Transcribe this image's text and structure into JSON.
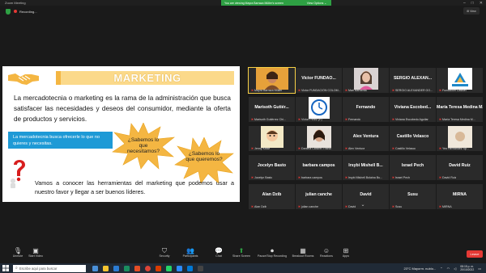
{
  "window": {
    "title": "Zoom Meeting",
    "share_banner": "You are viewing Mayra Barraza Müller's screen",
    "view_options": "View Options ⌄",
    "recording": "Recording...",
    "speaker_view": "⊞ View"
  },
  "slide": {
    "title": "MARKETING",
    "paragraph": "La mercadotecnia o marketing es la rama de la administración que busca satisfacer las necesidades y deseos del consumidor, mediante la oferta de productos y servicios.",
    "blue_box": "La mercadotecnia busca ofrecerle lo que no quieres y necesitas.",
    "burst1": "¿Sabemos lo que necesitamos?",
    "burst2": "¿Sabemos lo que queremos?",
    "bottom_text": "Vamos a conocer las herramientas del marketing que podemos usar a nuestro favor y llegar a ser buenos líderes."
  },
  "gallery": {
    "participants": [
      {
        "name": "",
        "label": "Mayra Barraza Müller",
        "photo": "woman-yellow"
      },
      {
        "name": "Victor FUNDAO...",
        "label": "Victor FUNDACIÓN COLOM..."
      },
      {
        "name": "",
        "label": "Mari Barberita",
        "photo": "girl-pink"
      },
      {
        "name": "SERGIO ALEXAN...",
        "label": "SERGIO ALEXANDER GO..."
      },
      {
        "name": "",
        "label": "Fundación Cassiel",
        "photo": "logo-fundacion"
      },
      {
        "name": "Marisoth Gutiér...",
        "label": "Marisoth Gutiérrez Chi..."
      },
      {
        "name": "",
        "label": "Víctor Pérez (P)",
        "photo": "clock-logo"
      },
      {
        "name": "Fernando",
        "label": "Fernando"
      },
      {
        "name": "Viviana Escobed...",
        "label": "Viviana Escobedo Aguilar"
      },
      {
        "name": "María Teresa Medina M...",
        "label": "María Teresa Medina M..."
      },
      {
        "name": "",
        "label": "Jenny Kisse",
        "photo": "cartoon"
      },
      {
        "name": "",
        "label": "Daniela Caravel Triana",
        "photo": "girl-face"
      },
      {
        "name": "Alex Ventura",
        "label": "Alex Ventura"
      },
      {
        "name": "Castillo Velasco",
        "label": "Castillo Velasco"
      },
      {
        "name": "",
        "label": "Yeo Hernández Sp...",
        "photo": "beige"
      },
      {
        "name": "Jocelyn Basto",
        "label": "Jocelyn Basto"
      },
      {
        "name": "barbara campos",
        "label": "barbara campos"
      },
      {
        "name": "Irsybi Mishell B...",
        "label": "Irsybi Mishell Bolaina Bu..."
      },
      {
        "name": "Israel Pech",
        "label": "Israel Pech"
      },
      {
        "name": "David Ruiz",
        "label": "David Ruiz"
      },
      {
        "name": "Alan Dzib",
        "label": "Alan Dzib"
      },
      {
        "name": "julian canche",
        "label": "julian canche"
      },
      {
        "name": "David",
        "label": "David"
      },
      {
        "name": "Susu",
        "label": "Susu"
      },
      {
        "name": "MIRNA",
        "label": "MIRNA"
      }
    ],
    "more": "⌄"
  },
  "toolbar": {
    "items": [
      {
        "label": "Unmute",
        "icon": "mic-muted-icon"
      },
      {
        "label": "Start Video",
        "icon": "video-off-icon"
      },
      {
        "label": "Security",
        "icon": "shield-icon"
      },
      {
        "label": "Participants",
        "icon": "participants-icon",
        "count": "30"
      },
      {
        "label": "Chat",
        "icon": "chat-icon"
      },
      {
        "label": "Share Screen",
        "icon": "share-screen-icon"
      },
      {
        "label": "Pause/Stop Recording",
        "icon": "record-icon"
      },
      {
        "label": "Breakout Rooms",
        "icon": "breakout-icon"
      },
      {
        "label": "Reactions",
        "icon": "smile-icon"
      },
      {
        "label": "Apps",
        "icon": "apps-icon"
      }
    ],
    "leave": "Leave"
  },
  "taskbar": {
    "search_placeholder": "Escribe aquí para buscar",
    "weather": "23°C  Mayorm. nublo...",
    "time": "08:15 p. m.",
    "date": "20/10/2022"
  },
  "colors": {
    "accent_green": "#2ea043",
    "slide_title_bar": "#fbd98a",
    "blue_box": "#1e9ad6",
    "burst": "#f4b642",
    "leave_red": "#e53935"
  }
}
